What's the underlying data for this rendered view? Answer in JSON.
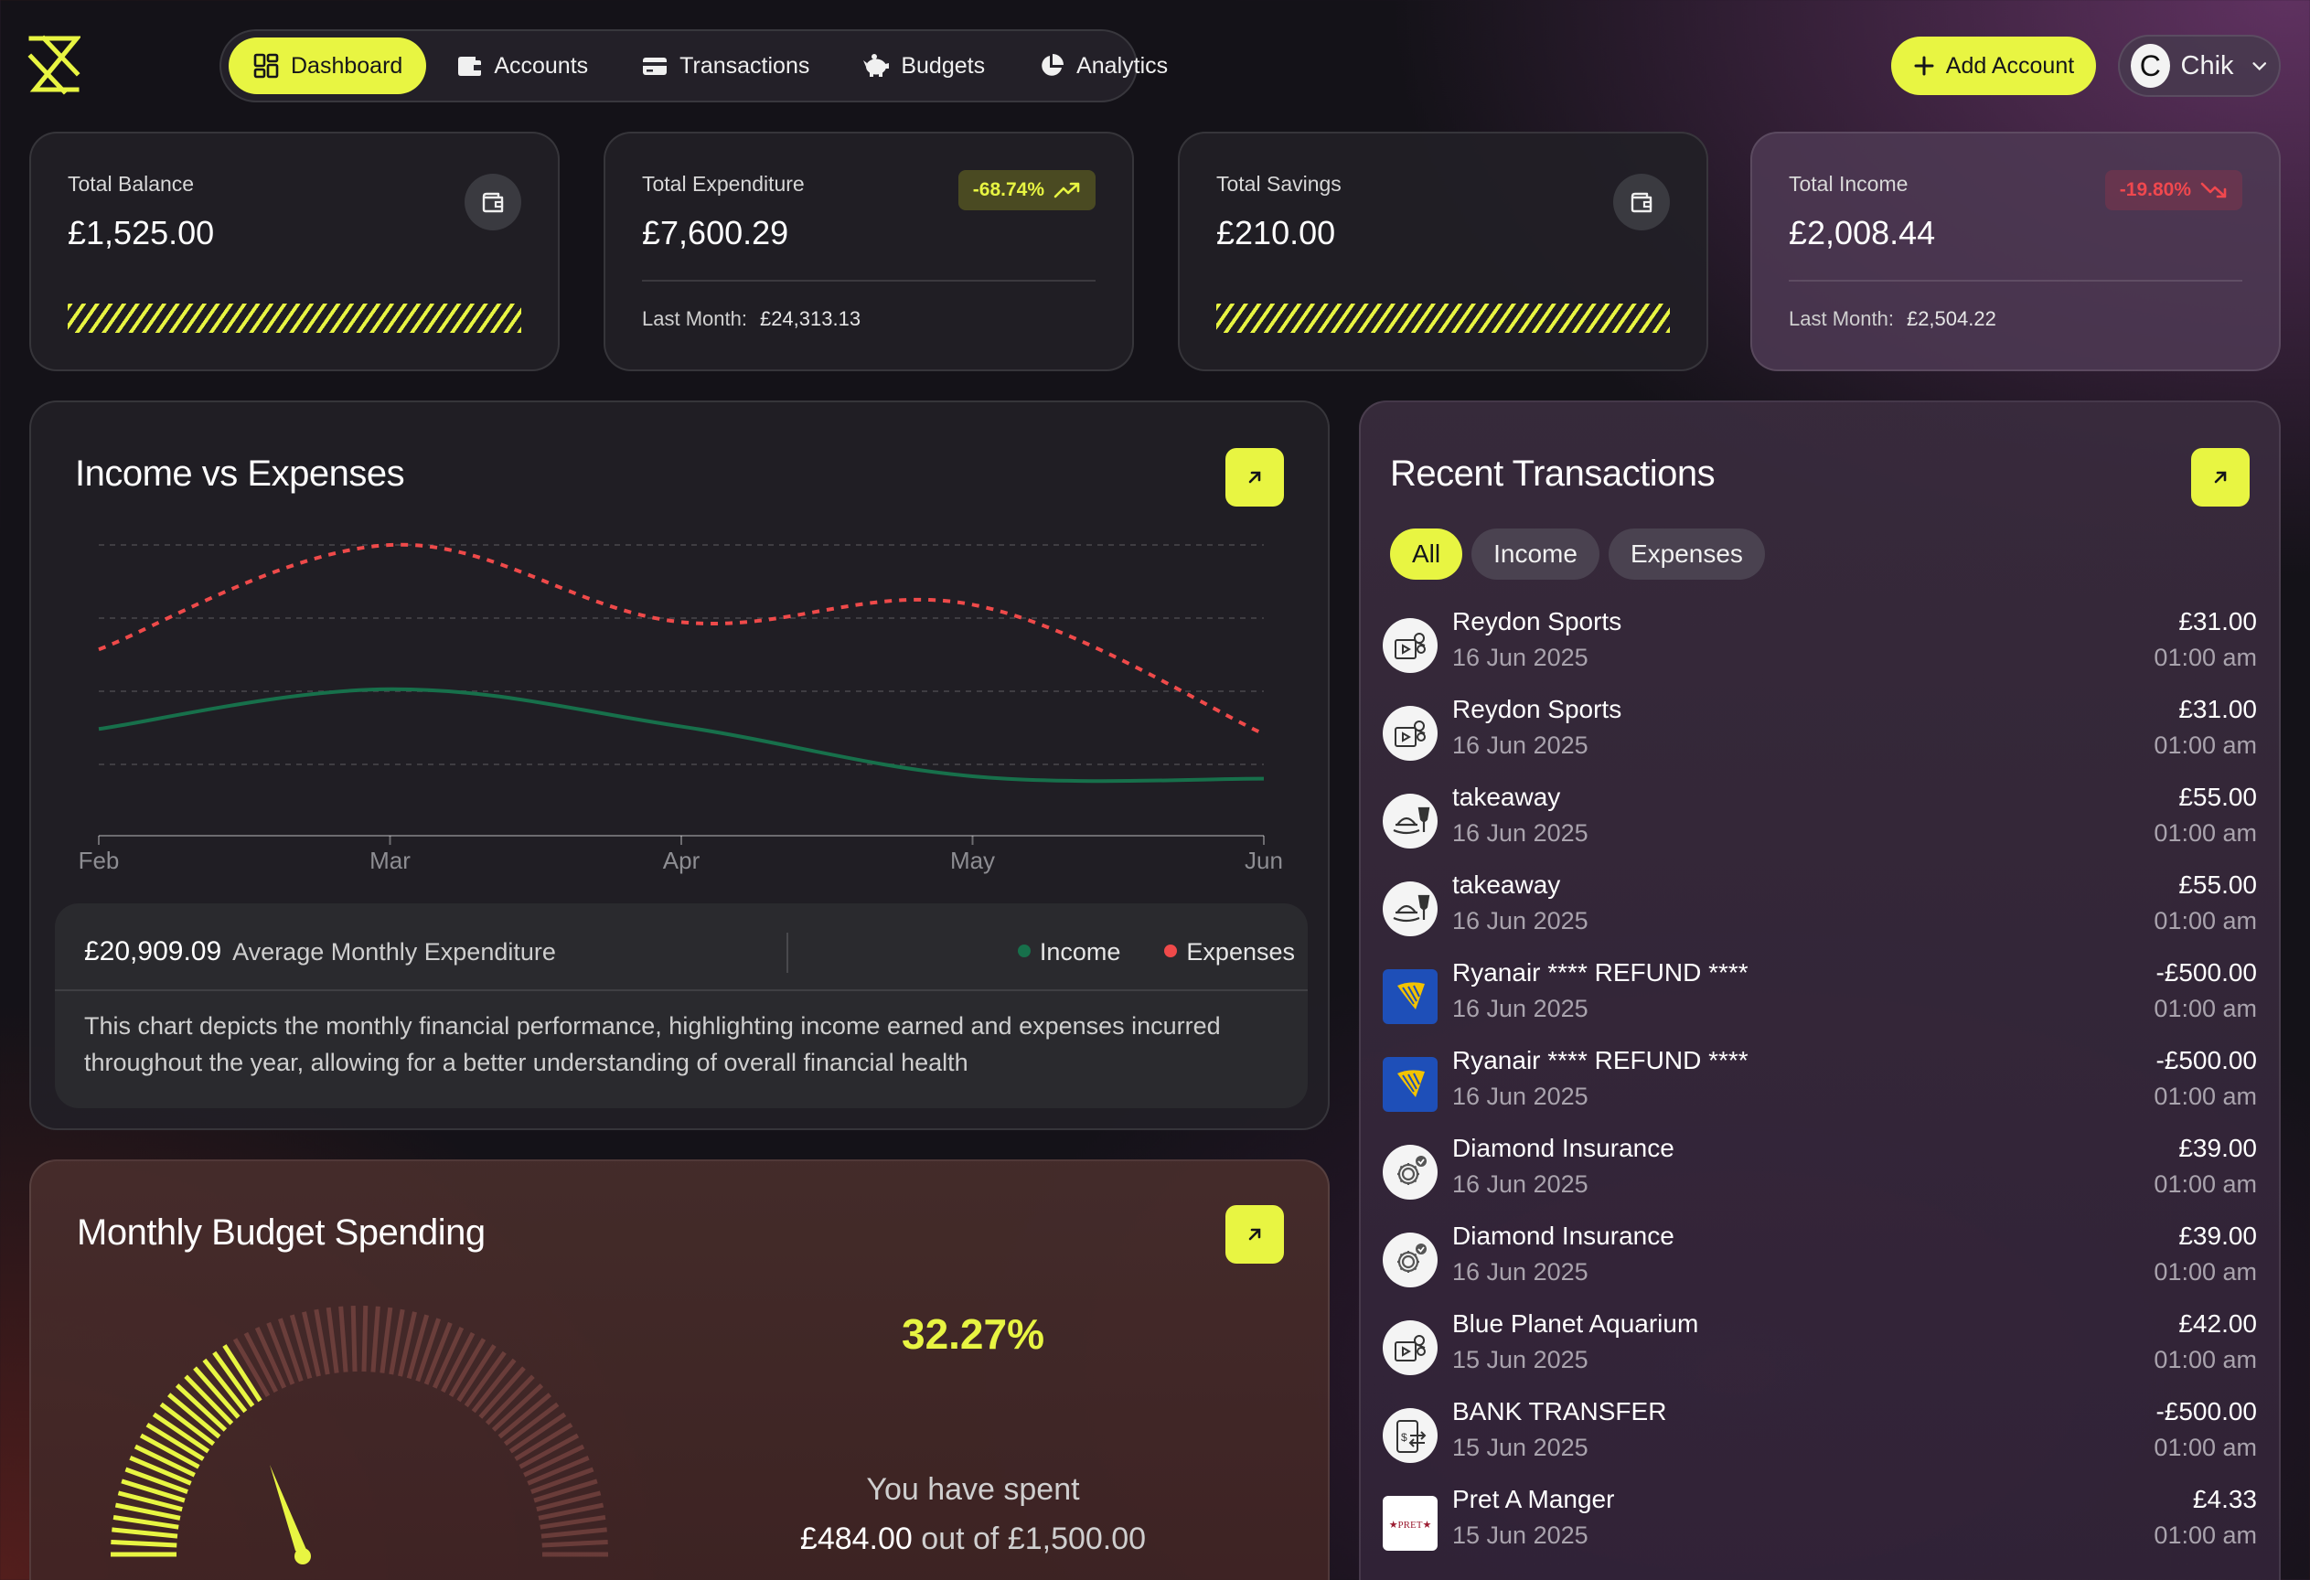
{
  "colors": {
    "accent": "#e8f542",
    "income": "#17704b",
    "expenses": "#ef4a4a",
    "negative": "#f0484e"
  },
  "nav": {
    "items": [
      {
        "label": "Dashboard",
        "icon": "dashboard-grid-icon",
        "active": true
      },
      {
        "label": "Accounts",
        "icon": "wallet-icon",
        "active": false
      },
      {
        "label": "Transactions",
        "icon": "credit-card-icon",
        "active": false
      },
      {
        "label": "Budgets",
        "icon": "piggy-bank-icon",
        "active": false
      },
      {
        "label": "Analytics",
        "icon": "pie-chart-icon",
        "active": false
      }
    ]
  },
  "header": {
    "add_account": "Add Account",
    "user_initial": "C",
    "user_name": "Chik"
  },
  "stats": [
    {
      "label": "Total Balance",
      "value": "£1,525.00",
      "icon": "wallet-icon"
    },
    {
      "label": "Total Expenditure",
      "value": "£7,600.29",
      "badge": "-68.74%",
      "badge_icon": "trend-up-icon",
      "last_month_label": "Last Month:",
      "last_month_value": "£24,313.13"
    },
    {
      "label": "Total Savings",
      "value": "£210.00",
      "icon": "wallet-icon"
    },
    {
      "label": "Total Income",
      "value": "£2,008.44",
      "badge": "-19.80%",
      "badge_icon": "trend-down-icon",
      "last_month_label": "Last Month:",
      "last_month_value": "£2,504.22"
    }
  ],
  "income_expenses": {
    "title": "Income vs Expenses",
    "average_value": "£20,909.09",
    "average_label": "Average Monthly Expenditure",
    "legend_income": "Income",
    "legend_expenses": "Expenses",
    "description": "This chart depicts the monthly financial performance, highlighting income earned and expenses incurred throughout the year, allowing for a better understanding of overall financial health"
  },
  "chart_data": {
    "type": "line",
    "categories": [
      "Feb",
      "Mar",
      "Apr",
      "May",
      "Jun"
    ],
    "series": [
      {
        "name": "Income",
        "values": [
          0.26,
          0.42,
          0.27,
          0.07,
          0.06
        ],
        "color": "#17704b",
        "style": "solid"
      },
      {
        "name": "Expenses",
        "values": [
          0.58,
          1.0,
          0.69,
          0.76,
          0.24
        ],
        "color": "#ef4a4a",
        "style": "dashed"
      }
    ],
    "ylim": [
      0,
      1.0
    ],
    "grid": true,
    "y_axis_labels": false
  },
  "budget": {
    "title": "Monthly Budget Spending",
    "percent": "32.27%",
    "percent_value": 0.3227,
    "spent_label": "You have spent",
    "spent_amount": "£484.00",
    "out_of_label": "out of",
    "total_amount": "£1,500.00"
  },
  "transactions": {
    "title": "Recent Transactions",
    "filters": [
      "All",
      "Income",
      "Expenses"
    ],
    "active_filter": "All",
    "items": [
      {
        "name": "Reydon Sports",
        "date": "16 Jun 2025",
        "amount": "£31.00",
        "time": "01:00 am",
        "icon": "entertainment-icon"
      },
      {
        "name": "Reydon Sports",
        "date": "16 Jun 2025",
        "amount": "£31.00",
        "time": "01:00 am",
        "icon": "entertainment-icon"
      },
      {
        "name": "takeaway",
        "date": "16 Jun 2025",
        "amount": "£55.00",
        "time": "01:00 am",
        "icon": "food-drink-icon"
      },
      {
        "name": "takeaway",
        "date": "16 Jun 2025",
        "amount": "£55.00",
        "time": "01:00 am",
        "icon": "food-drink-icon"
      },
      {
        "name": "Ryanair **** REFUND ****",
        "date": "16 Jun 2025",
        "amount": "-£500.00",
        "time": "01:00 am",
        "icon": "ryanair-logo-icon"
      },
      {
        "name": "Ryanair **** REFUND ****",
        "date": "16 Jun 2025",
        "amount": "-£500.00",
        "time": "01:00 am",
        "icon": "ryanair-logo-icon"
      },
      {
        "name": "Diamond Insurance",
        "date": "16 Jun 2025",
        "amount": "£39.00",
        "time": "01:00 am",
        "icon": "insurance-gear-icon"
      },
      {
        "name": "Diamond Insurance",
        "date": "16 Jun 2025",
        "amount": "£39.00",
        "time": "01:00 am",
        "icon": "insurance-gear-icon"
      },
      {
        "name": "Blue Planet Aquarium",
        "date": "15 Jun 2025",
        "amount": "£42.00",
        "time": "01:00 am",
        "icon": "entertainment-icon"
      },
      {
        "name": "BANK TRANSFER",
        "date": "15 Jun 2025",
        "amount": "-£500.00",
        "time": "01:00 am",
        "icon": "bank-transfer-icon"
      },
      {
        "name": "Pret A Manger",
        "date": "15 Jun 2025",
        "amount": "£4.33",
        "time": "01:00 am",
        "icon": "pret-logo-icon"
      }
    ]
  }
}
